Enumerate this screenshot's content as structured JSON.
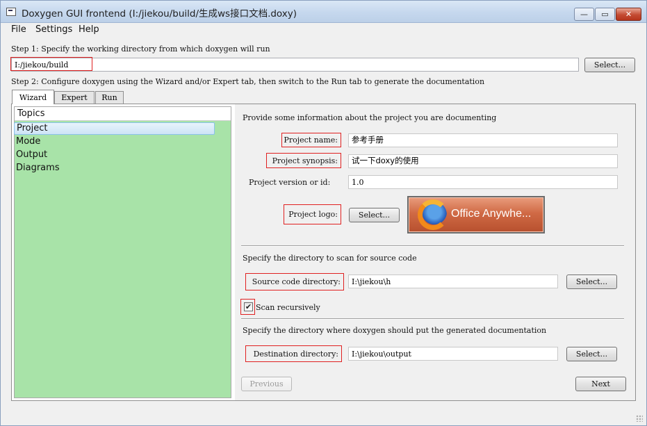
{
  "window": {
    "title": "Doxygen GUI frontend (I:/jiekou/build/生成ws接口文档.doxy)",
    "controls": {
      "minimize": "—",
      "maximize": "▭",
      "close": "✕"
    }
  },
  "menu": {
    "file": "File",
    "settings": "Settings",
    "help": "Help"
  },
  "step1": {
    "label": "Step 1: Specify the working directory from which doxygen will run",
    "dir_value": "I:/jiekou/build",
    "select": "Select..."
  },
  "step2": {
    "label": "Step 2: Configure doxygen using the Wizard and/or Expert tab, then switch to the Run tab to generate the documentation"
  },
  "tabs": [
    {
      "label": "Wizard"
    },
    {
      "label": "Expert"
    },
    {
      "label": "Run"
    }
  ],
  "topics": {
    "header": "Topics",
    "items": [
      {
        "label": "Project"
      },
      {
        "label": "Mode"
      },
      {
        "label": "Output"
      },
      {
        "label": "Diagrams"
      }
    ],
    "selected": "Project"
  },
  "project": {
    "intro": "Provide some information about the project you are documenting",
    "name_label": "Project name:",
    "name_value": "参考手册",
    "synopsis_label": "Project synopsis:",
    "synopsis_value": "试一下doxy的使用",
    "version_label": "Project version or id:",
    "version_value": "1.0",
    "logo_label": "Project logo:",
    "logo_select": "Select...",
    "logo_text": "Office Anywhe..."
  },
  "source": {
    "intro": "Specify the directory to scan for source code",
    "dir_label": "Source code directory:",
    "dir_value": "I:\\jiekou\\h",
    "select": "Select...",
    "scan_recursively_label": "Scan recursively",
    "scan_recursively_checked": true
  },
  "destination": {
    "intro": "Specify the directory where doxygen should put the generated documentation",
    "dir_label": "Destination directory:",
    "dir_value": "I:\\jiekou\\output",
    "select": "Select..."
  },
  "nav": {
    "previous": "Previous",
    "next": "Next"
  },
  "colors": {
    "topics_bg": "#a8e3a8",
    "highlight_box": "#e02020",
    "titlebar": "#c6d8ee"
  },
  "icons": {
    "checkbox": "✔"
  }
}
